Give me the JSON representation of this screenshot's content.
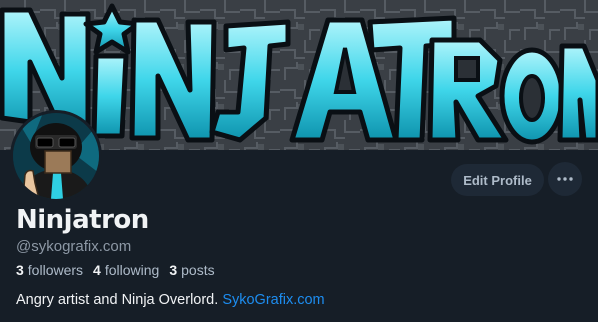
{
  "banner": {
    "logo_text": "NINJATRON",
    "accent_color": "#3fd6ea"
  },
  "profile": {
    "display_name": "Ninjatron",
    "handle": "@sykografix.com",
    "stats": {
      "followers_count": "3",
      "followers_label": "followers",
      "following_count": "4",
      "following_label": "following",
      "posts_count": "3",
      "posts_label": "posts"
    },
    "bio": {
      "text": "Angry artist and Ninja Overlord.",
      "link": "SykoGrafix.com"
    }
  },
  "actions": {
    "edit_profile_label": "Edit Profile",
    "more_icon": "ellipsis-icon"
  },
  "colors": {
    "background": "#161e27",
    "button_bg": "#1e2936",
    "link": "#1d8df0",
    "muted_text": "#8d98a5"
  }
}
